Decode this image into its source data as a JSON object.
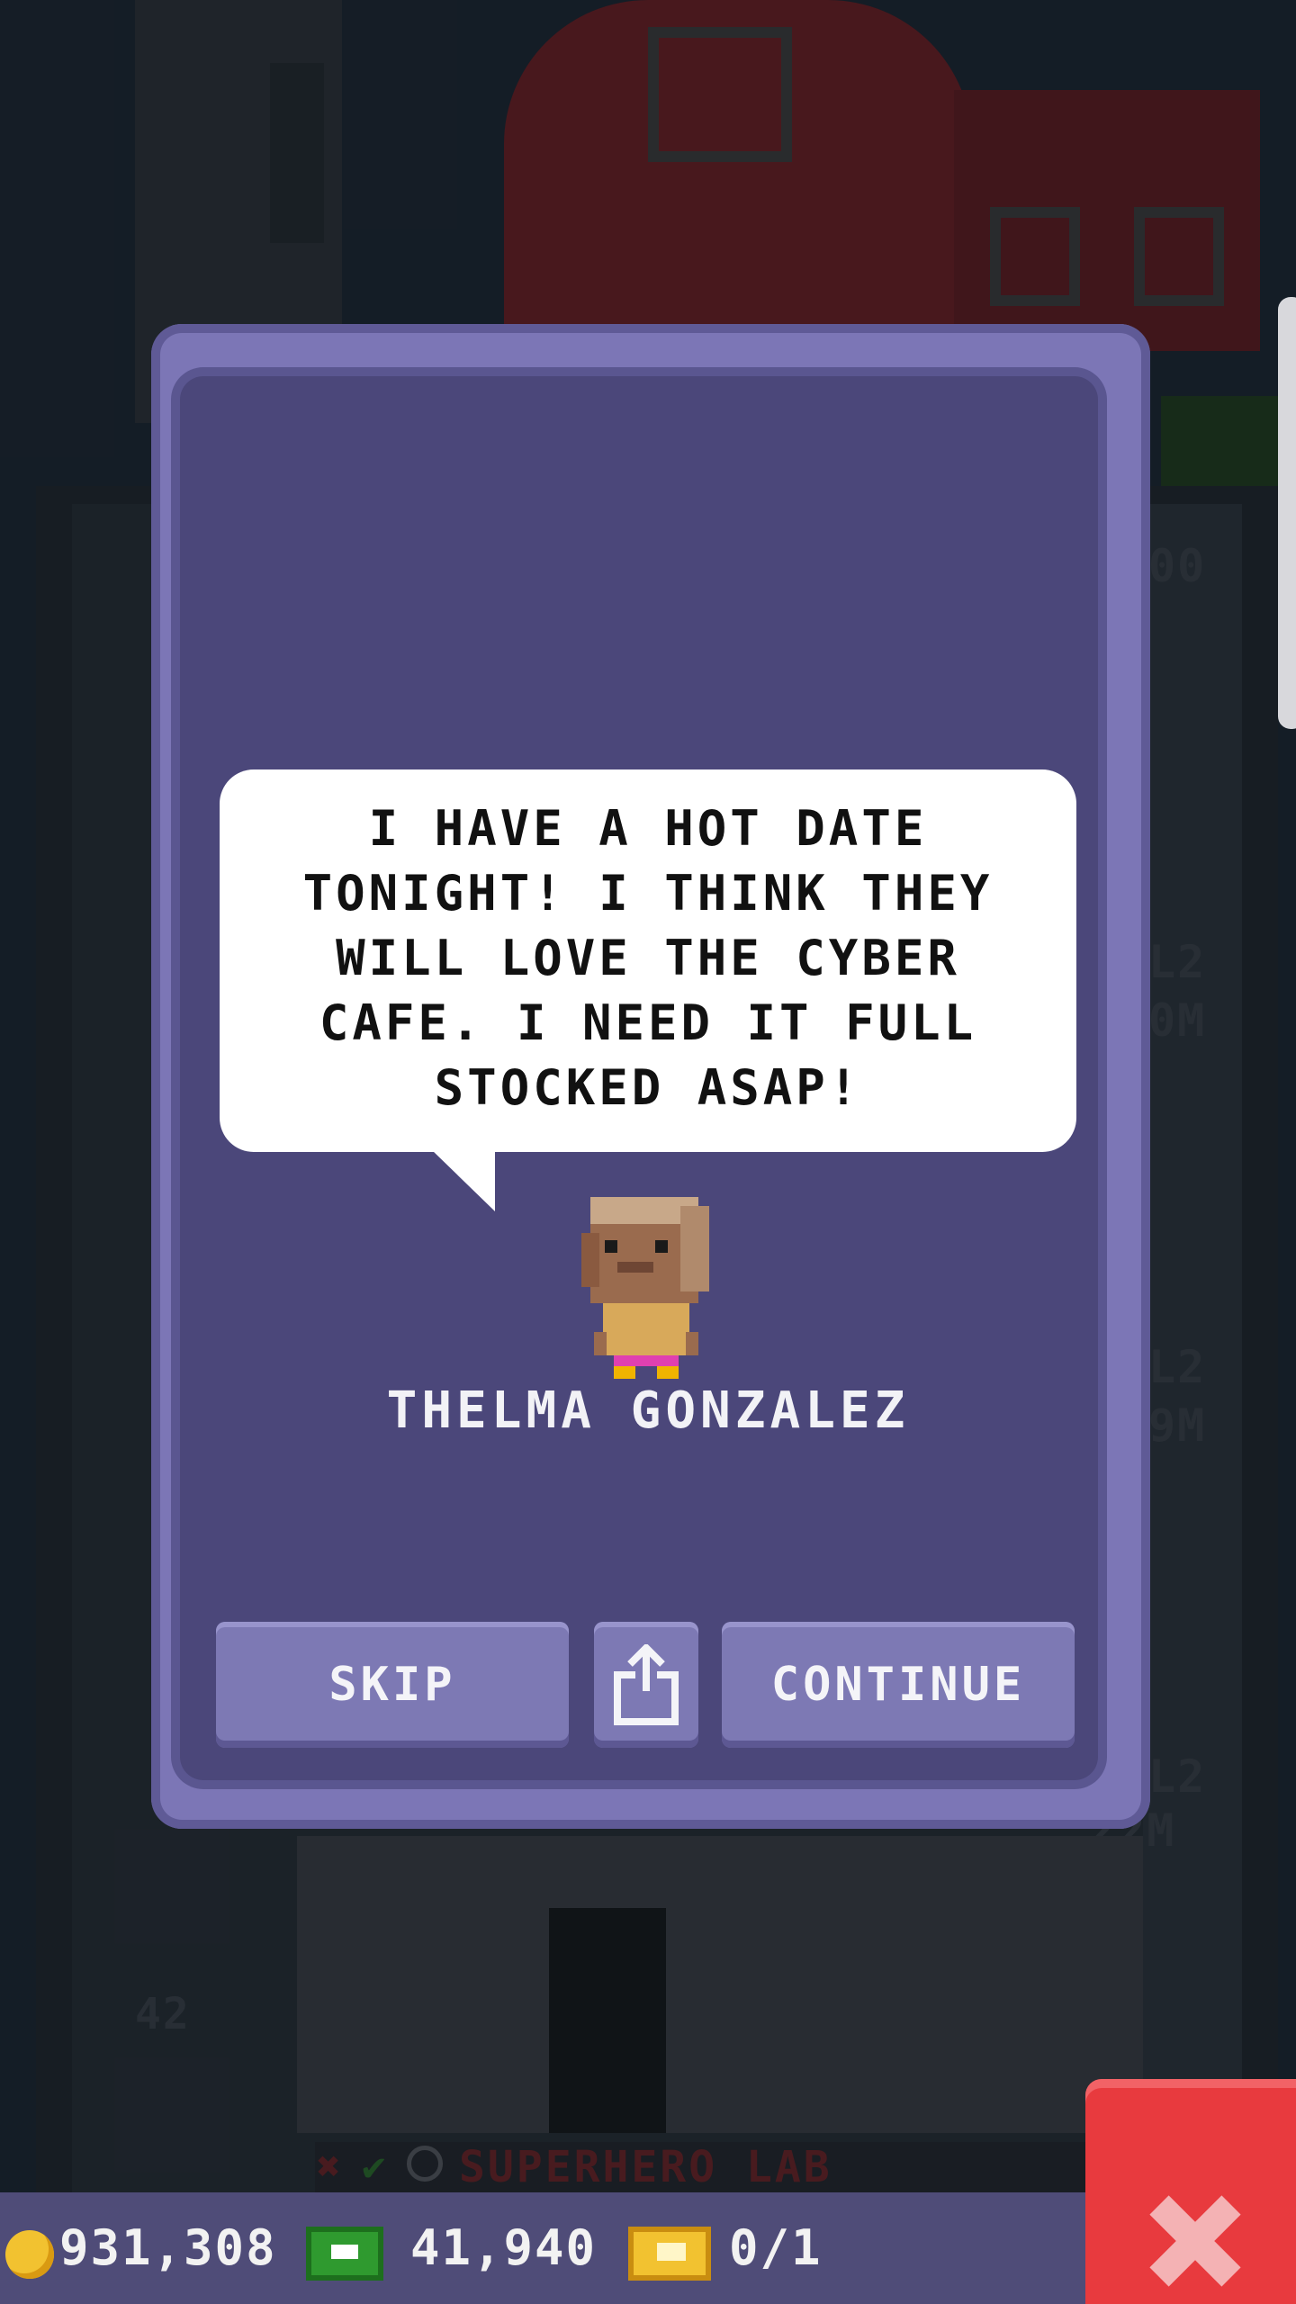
{
  "dialog": {
    "speech": "I HAVE A HOT DATE TONIGHT! I THINK THEY WILL LOVE THE CYBER CAFE. I NEED IT FULL STOCKED ASAP!",
    "character_name": "THELMA GONZALEZ",
    "skip_label": "SKIP",
    "continue_label": "CONTINUE",
    "share_icon": "share-icon"
  },
  "background": {
    "floor_number": "42",
    "floor_name": "SUPERHERO LAB",
    "side_labels": [
      "00",
      "L2",
      "0M",
      "L2",
      "9M",
      "L2",
      "22M"
    ]
  },
  "status_bar": {
    "coins": "931,308",
    "bux": "41,940",
    "tickets": "0/1"
  },
  "colors": {
    "dialog_frame": "#7c76b6",
    "dialog_body": "#4b477a",
    "button": "#7d79b4",
    "close_button": "#e83a3e",
    "status_bar": "#4f4c78"
  }
}
